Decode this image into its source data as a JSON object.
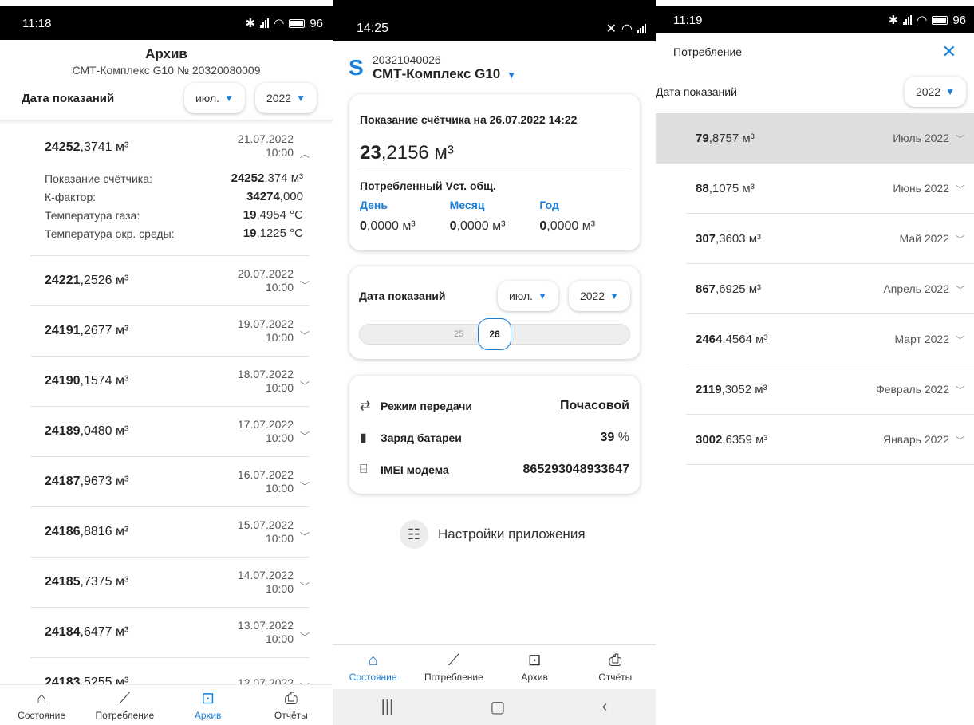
{
  "archive": {
    "status": {
      "time": "11:18",
      "battery": "96"
    },
    "title": "Архив",
    "subtitle": "СМТ-Комплекс G10 № 20320080009",
    "filter": {
      "label": "Дата показаний",
      "month": "июл.",
      "year": "2022"
    },
    "expanded": {
      "value_int": "24252",
      "value_frac": ",3741 м³",
      "date": "21.07.2022",
      "time": "10:00",
      "details": [
        {
          "label": "Показание счётчика:",
          "int": "24252",
          "frac": ",374 м³"
        },
        {
          "label": "К-фактор:",
          "int": "34274",
          "frac": ",000"
        },
        {
          "label": "Температура газа:",
          "int": "19",
          "frac": ",4954 °С"
        },
        {
          "label": "Температура окр. среды:",
          "int": "19",
          "frac": ",1225 °С"
        }
      ]
    },
    "rows": [
      {
        "int": "24221",
        "frac": ",2526 м³",
        "date": "20.07.2022",
        "time": "10:00"
      },
      {
        "int": "24191",
        "frac": ",2677 м³",
        "date": "19.07.2022",
        "time": "10:00"
      },
      {
        "int": "24190",
        "frac": ",1574 м³",
        "date": "18.07.2022",
        "time": "10:00"
      },
      {
        "int": "24189",
        "frac": ",0480 м³",
        "date": "17.07.2022",
        "time": "10:00"
      },
      {
        "int": "24187",
        "frac": ",9673 м³",
        "date": "16.07.2022",
        "time": "10:00"
      },
      {
        "int": "24186",
        "frac": ",8816 м³",
        "date": "15.07.2022",
        "time": "10:00"
      },
      {
        "int": "24185",
        "frac": ",7375 м³",
        "date": "14.07.2022",
        "time": "10:00"
      },
      {
        "int": "24184",
        "frac": ",6477 м³",
        "date": "13.07.2022",
        "time": "10:00"
      },
      {
        "int": "24183",
        "frac": ",5255 м³",
        "date": "12.07.2022",
        "time": ""
      }
    ]
  },
  "tabs": {
    "state": "Состояние",
    "consumption": "Потребление",
    "archive": "Архив",
    "reports": "Отчёты"
  },
  "state": {
    "status": {
      "time": "14:25"
    },
    "device_number": "20321040026",
    "device_name": "СМТ-Комплекс G10",
    "reading_label": "Показание счётчика на 26.07.2022 14:22",
    "reading_int": "23",
    "reading_frac": ",2156 м³",
    "consumed_label": "Потребленный Vст. общ.",
    "periods": [
      {
        "label": "День",
        "int": "0",
        "frac": ",0000 м³"
      },
      {
        "label": "Месяц",
        "int": "0",
        "frac": ",0000 м³"
      },
      {
        "label": "Год",
        "int": "0",
        "frac": ",0000 м³"
      }
    ],
    "filter": {
      "label": "Дата показаний",
      "month": "июл.",
      "year": "2022"
    },
    "days": {
      "prev": "25",
      "selected": "26"
    },
    "info": {
      "mode_label": "Режим передачи",
      "mode_value": "Почасовой",
      "battery_label": "Заряд батареи",
      "battery_value": "39",
      "battery_unit": "%",
      "imei_label": "IMEI модема",
      "imei_value": "865293048933647"
    },
    "settings_label": "Настройки приложения"
  },
  "consumption": {
    "status": {
      "time": "11:19",
      "battery": "96"
    },
    "title": "Потребление",
    "filter": {
      "label": "Дата показаний",
      "year": "2022"
    },
    "rows": [
      {
        "int": "79",
        "frac": ",8757 м³",
        "month": "Июль 2022"
      },
      {
        "int": "88",
        "frac": ",1075 м³",
        "month": "Июнь 2022"
      },
      {
        "int": "307",
        "frac": ",3603 м³",
        "month": "Май 2022"
      },
      {
        "int": "867",
        "frac": ",6925 м³",
        "month": "Апрель 2022"
      },
      {
        "int": "2464",
        "frac": ",4564 м³",
        "month": "Март 2022"
      },
      {
        "int": "2119",
        "frac": ",3052 м³",
        "month": "Февраль 2022"
      },
      {
        "int": "3002",
        "frac": ",6359 м³",
        "month": "Январь 2022"
      }
    ]
  },
  "colors": {
    "accent": "#1a7fd8",
    "selected_row": "#dedede"
  }
}
